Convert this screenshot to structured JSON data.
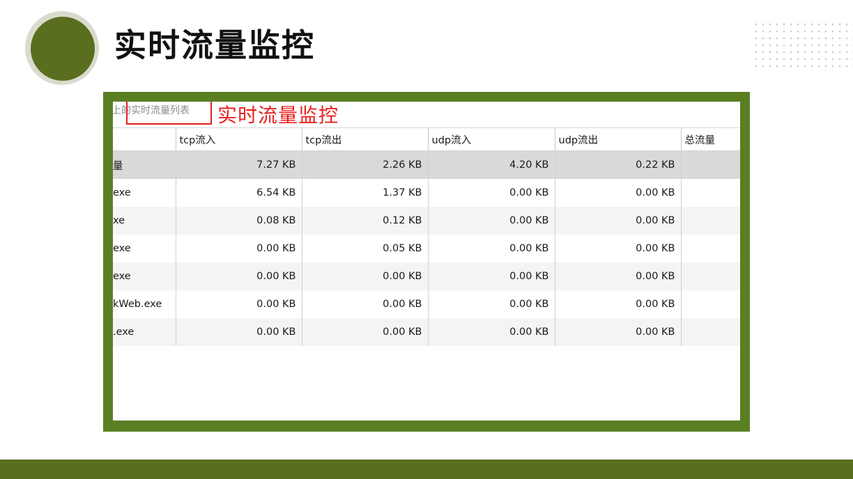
{
  "slide": {
    "title": "实时流量监控"
  },
  "screenshot": {
    "caption": "上的实时流量列表",
    "annotation": "实时流量监控",
    "columns": [
      "",
      "tcp流入",
      "tcp流出",
      "udp流入",
      "udp流出",
      "总流量"
    ],
    "rows": [
      {
        "name": "量",
        "tcp_in": "7.27 KB",
        "tcp_out": "2.26 KB",
        "udp_in": "4.20 KB",
        "udp_out": "0.22 KB",
        "total": ""
      },
      {
        "name": "exe",
        "tcp_in": "6.54 KB",
        "tcp_out": "1.37 KB",
        "udp_in": "0.00 KB",
        "udp_out": "0.00 KB",
        "total": ""
      },
      {
        "name": "xe",
        "tcp_in": "0.08 KB",
        "tcp_out": "0.12 KB",
        "udp_in": "0.00 KB",
        "udp_out": "0.00 KB",
        "total": ""
      },
      {
        "name": "exe",
        "tcp_in": "0.00 KB",
        "tcp_out": "0.05 KB",
        "udp_in": "0.00 KB",
        "udp_out": "0.00 KB",
        "total": ""
      },
      {
        "name": "exe",
        "tcp_in": "0.00 KB",
        "tcp_out": "0.00 KB",
        "udp_in": "0.00 KB",
        "udp_out": "0.00 KB",
        "total": ""
      },
      {
        "name": "kWeb.exe",
        "tcp_in": "0.00 KB",
        "tcp_out": "0.00 KB",
        "udp_in": "0.00 KB",
        "udp_out": "0.00 KB",
        "total": ""
      },
      {
        "name": ".exe",
        "tcp_in": "0.00 KB",
        "tcp_out": "0.00 KB",
        "udp_in": "0.00 KB",
        "udp_out": "0.00 KB",
        "total": ""
      }
    ]
  },
  "colors": {
    "accent": "#5a6e1f",
    "frame": "#5a7f23",
    "annotation": "#e8201f"
  }
}
